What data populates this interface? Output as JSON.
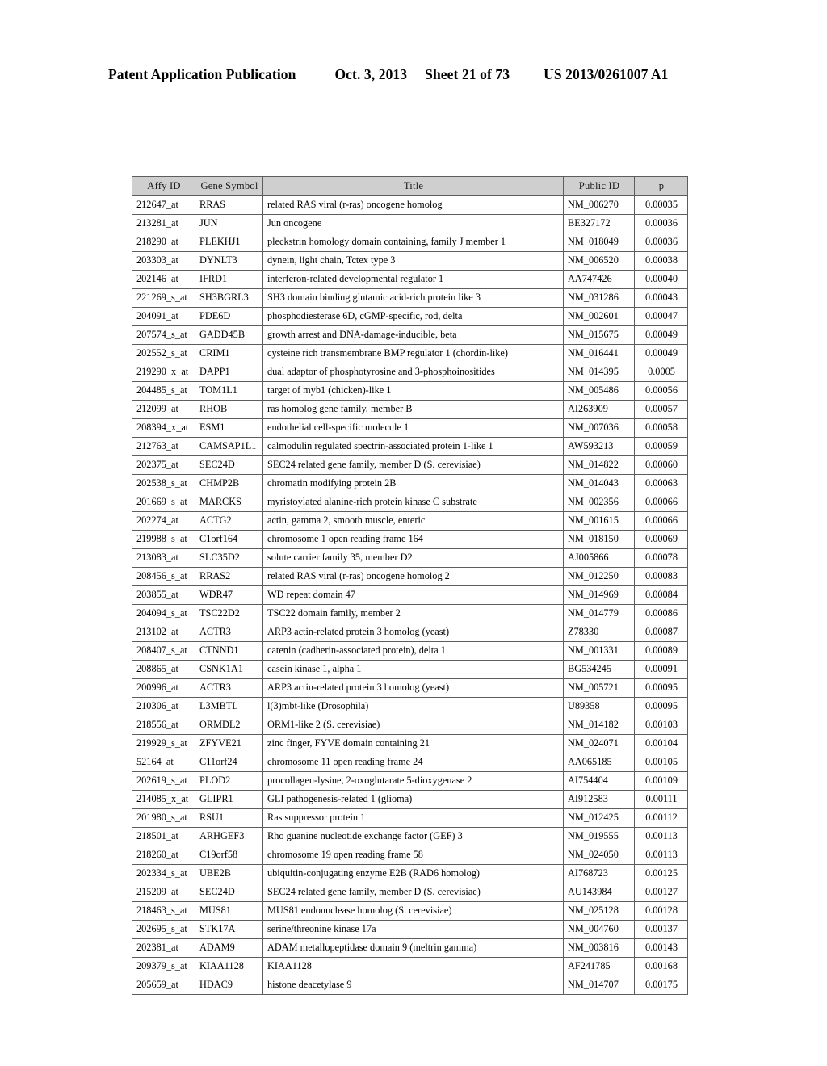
{
  "header": {
    "publication": "Patent Application Publication",
    "date": "Oct. 3, 2013",
    "sheet": "Sheet 21 of 73",
    "patent_number": "US 2013/0261007 A1"
  },
  "table": {
    "columns": [
      "Affy ID",
      "Gene Symbol",
      "Title",
      "Public ID",
      "p"
    ],
    "rows": [
      {
        "affy": "212647_at",
        "symbol": "RRAS",
        "title": "related RAS viral (r-ras) oncogene homolog",
        "public_id": "NM_006270",
        "p": "0.00035"
      },
      {
        "affy": "213281_at",
        "symbol": "JUN",
        "title": "Jun oncogene",
        "public_id": "BE327172",
        "p": "0.00036"
      },
      {
        "affy": "218290_at",
        "symbol": "PLEKHJ1",
        "title": "pleckstrin homology domain containing, family J member 1",
        "public_id": "NM_018049",
        "p": "0.00036"
      },
      {
        "affy": "203303_at",
        "symbol": "DYNLT3",
        "title": "dynein, light chain, Tctex type 3",
        "public_id": "NM_006520",
        "p": "0.00038"
      },
      {
        "affy": "202146_at",
        "symbol": "IFRD1",
        "title": "interferon-related developmental regulator 1",
        "public_id": "AA747426",
        "p": "0.00040"
      },
      {
        "affy": "221269_s_at",
        "symbol": "SH3BGRL3",
        "title": "SH3 domain binding glutamic acid-rich protein like 3",
        "public_id": "NM_031286",
        "p": "0.00043"
      },
      {
        "affy": "204091_at",
        "symbol": "PDE6D",
        "title": "phosphodiesterase 6D, cGMP-specific, rod, delta",
        "public_id": "NM_002601",
        "p": "0.00047"
      },
      {
        "affy": "207574_s_at",
        "symbol": "GADD45B",
        "title": "growth arrest and DNA-damage-inducible, beta",
        "public_id": "NM_015675",
        "p": "0.00049"
      },
      {
        "affy": "202552_s_at",
        "symbol": "CRIM1",
        "title": "cysteine rich transmembrane BMP regulator 1 (chordin-like)",
        "public_id": "NM_016441",
        "p": "0.00049"
      },
      {
        "affy": "219290_x_at",
        "symbol": "DAPP1",
        "title": "dual adaptor of phosphotyrosine and 3-phosphoinositides",
        "public_id": "NM_014395",
        "p": "0.0005"
      },
      {
        "affy": "204485_s_at",
        "symbol": "TOM1L1",
        "title": "target of myb1 (chicken)-like 1",
        "public_id": "NM_005486",
        "p": "0.00056"
      },
      {
        "affy": "212099_at",
        "symbol": "RHOB",
        "title": "ras homolog gene family, member B",
        "public_id": "AI263909",
        "p": "0.00057"
      },
      {
        "affy": "208394_x_at",
        "symbol": "ESM1",
        "title": "endothelial cell-specific molecule 1",
        "public_id": "NM_007036",
        "p": "0.00058"
      },
      {
        "affy": "212763_at",
        "symbol": "CAMSAP1L1",
        "title": "calmodulin regulated spectrin-associated protein 1-like 1",
        "public_id": "AW593213",
        "p": "0.00059"
      },
      {
        "affy": "202375_at",
        "symbol": "SEC24D",
        "title": "SEC24 related gene family, member D (S. cerevisiae)",
        "public_id": "NM_014822",
        "p": "0.00060"
      },
      {
        "affy": "202538_s_at",
        "symbol": "CHMP2B",
        "title": "chromatin modifying protein 2B",
        "public_id": "NM_014043",
        "p": "0.00063"
      },
      {
        "affy": "201669_s_at",
        "symbol": "MARCKS",
        "title": "myristoylated alanine-rich protein kinase C substrate",
        "public_id": "NM_002356",
        "p": "0.00066"
      },
      {
        "affy": "202274_at",
        "symbol": "ACTG2",
        "title": "actin, gamma 2, smooth muscle, enteric",
        "public_id": "NM_001615",
        "p": "0.00066"
      },
      {
        "affy": "219988_s_at",
        "symbol": "C1orf164",
        "title": "chromosome 1 open reading frame 164",
        "public_id": "NM_018150",
        "p": "0.00069"
      },
      {
        "affy": "213083_at",
        "symbol": "SLC35D2",
        "title": "solute carrier family 35, member D2",
        "public_id": "AJ005866",
        "p": "0.00078"
      },
      {
        "affy": "208456_s_at",
        "symbol": "RRAS2",
        "title": "related RAS viral (r-ras) oncogene homolog 2",
        "public_id": "NM_012250",
        "p": "0.00083"
      },
      {
        "affy": "203855_at",
        "symbol": "WDR47",
        "title": "WD repeat domain 47",
        "public_id": "NM_014969",
        "p": "0.00084"
      },
      {
        "affy": "204094_s_at",
        "symbol": "TSC22D2",
        "title": "TSC22 domain family, member 2",
        "public_id": "NM_014779",
        "p": "0.00086"
      },
      {
        "affy": "213102_at",
        "symbol": "ACTR3",
        "title": "ARP3 actin-related protein 3 homolog (yeast)",
        "public_id": "Z78330",
        "p": "0.00087"
      },
      {
        "affy": "208407_s_at",
        "symbol": "CTNND1",
        "title": "catenin (cadherin-associated protein), delta 1",
        "public_id": "NM_001331",
        "p": "0.00089"
      },
      {
        "affy": "208865_at",
        "symbol": "CSNK1A1",
        "title": "casein kinase 1, alpha 1",
        "public_id": "BG534245",
        "p": "0.00091"
      },
      {
        "affy": "200996_at",
        "symbol": "ACTR3",
        "title": "ARP3 actin-related protein 3 homolog (yeast)",
        "public_id": "NM_005721",
        "p": "0.00095"
      },
      {
        "affy": "210306_at",
        "symbol": "L3MBTL",
        "title": "l(3)mbt-like (Drosophila)",
        "public_id": "U89358",
        "p": "0.00095"
      },
      {
        "affy": "218556_at",
        "symbol": "ORMDL2",
        "title": "ORM1-like 2 (S. cerevisiae)",
        "public_id": "NM_014182",
        "p": "0.00103"
      },
      {
        "affy": "219929_s_at",
        "symbol": "ZFYVE21",
        "title": "zinc finger, FYVE domain containing 21",
        "public_id": "NM_024071",
        "p": "0.00104"
      },
      {
        "affy": "52164_at",
        "symbol": "C11orf24",
        "title": "chromosome 11 open reading frame 24",
        "public_id": "AA065185",
        "p": "0.00105"
      },
      {
        "affy": "202619_s_at",
        "symbol": "PLOD2",
        "title": "procollagen-lysine, 2-oxoglutarate 5-dioxygenase 2",
        "public_id": "AI754404",
        "p": "0.00109"
      },
      {
        "affy": "214085_x_at",
        "symbol": "GLIPR1",
        "title": "GLI pathogenesis-related 1 (glioma)",
        "public_id": "AI912583",
        "p": "0.00111"
      },
      {
        "affy": "201980_s_at",
        "symbol": "RSU1",
        "title": "Ras suppressor protein 1",
        "public_id": "NM_012425",
        "p": "0.00112"
      },
      {
        "affy": "218501_at",
        "symbol": "ARHGEF3",
        "title": "Rho guanine nucleotide exchange factor (GEF) 3",
        "public_id": "NM_019555",
        "p": "0.00113"
      },
      {
        "affy": "218260_at",
        "symbol": "C19orf58",
        "title": "chromosome 19 open reading frame 58",
        "public_id": "NM_024050",
        "p": "0.00113"
      },
      {
        "affy": "202334_s_at",
        "symbol": "UBE2B",
        "title": "ubiquitin-conjugating enzyme E2B (RAD6 homolog)",
        "public_id": "AI768723",
        "p": "0.00125"
      },
      {
        "affy": "215209_at",
        "symbol": "SEC24D",
        "title": "SEC24 related gene family, member D (S. cerevisiae)",
        "public_id": "AU143984",
        "p": "0.00127"
      },
      {
        "affy": "218463_s_at",
        "symbol": "MUS81",
        "title": "MUS81 endonuclease homolog (S. cerevisiae)",
        "public_id": "NM_025128",
        "p": "0.00128"
      },
      {
        "affy": "202695_s_at",
        "symbol": "STK17A",
        "title": "serine/threonine kinase 17a",
        "public_id": "NM_004760",
        "p": "0.00137"
      },
      {
        "affy": "202381_at",
        "symbol": "ADAM9",
        "title": "ADAM metallopeptidase domain 9 (meltrin gamma)",
        "public_id": "NM_003816",
        "p": "0.00143"
      },
      {
        "affy": "209379_s_at",
        "symbol": "KIAA1128",
        "title": "KIAA1128",
        "public_id": "AF241785",
        "p": "0.00168"
      },
      {
        "affy": "205659_at",
        "symbol": "HDAC9",
        "title": "histone deacetylase 9",
        "public_id": "NM_014707",
        "p": "0.00175"
      }
    ]
  }
}
